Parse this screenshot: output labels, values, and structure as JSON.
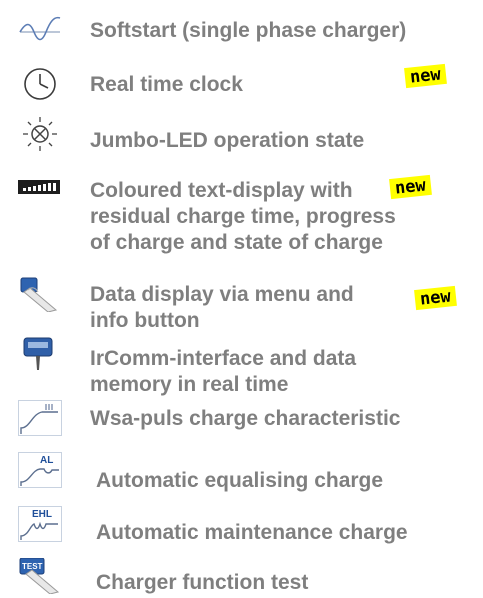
{
  "features": [
    {
      "label": "Softstart (single phase charger)",
      "icon": "sine-wave-icon"
    },
    {
      "label": "Real time clock",
      "icon": "clock-icon",
      "badge": "new"
    },
    {
      "label": "Jumbo-LED operation state",
      "icon": "led-icon"
    },
    {
      "lines": [
        "Coloured text-display with",
        "residual charge time, progress",
        "of charge and state of charge"
      ],
      "icon": "bar-display-icon",
      "badge": "new"
    },
    {
      "lines": [
        "Data display via menu and",
        "info button"
      ],
      "icon": "finger-press-icon",
      "badge": "new"
    },
    {
      "lines": [
        "IrComm-interface and data",
        "memory in real time"
      ],
      "icon": "ircomm-device-icon"
    },
    {
      "label": "Wsa-puls charge characteristic",
      "icon": "wsa-curve-icon"
    },
    {
      "label": "Automatic equalising charge",
      "icon": "al-curve-icon",
      "icon_text": "AL"
    },
    {
      "label": "Automatic maintenance charge",
      "icon": "ehl-curve-icon",
      "icon_text": "EHL"
    },
    {
      "label": "Charger function test",
      "icon": "test-button-icon",
      "icon_text": "TEST"
    }
  ],
  "colors": {
    "text": "#7f7f7f",
    "badge_bg": "#ffff00",
    "icon_blue": "#3a6fb5"
  }
}
